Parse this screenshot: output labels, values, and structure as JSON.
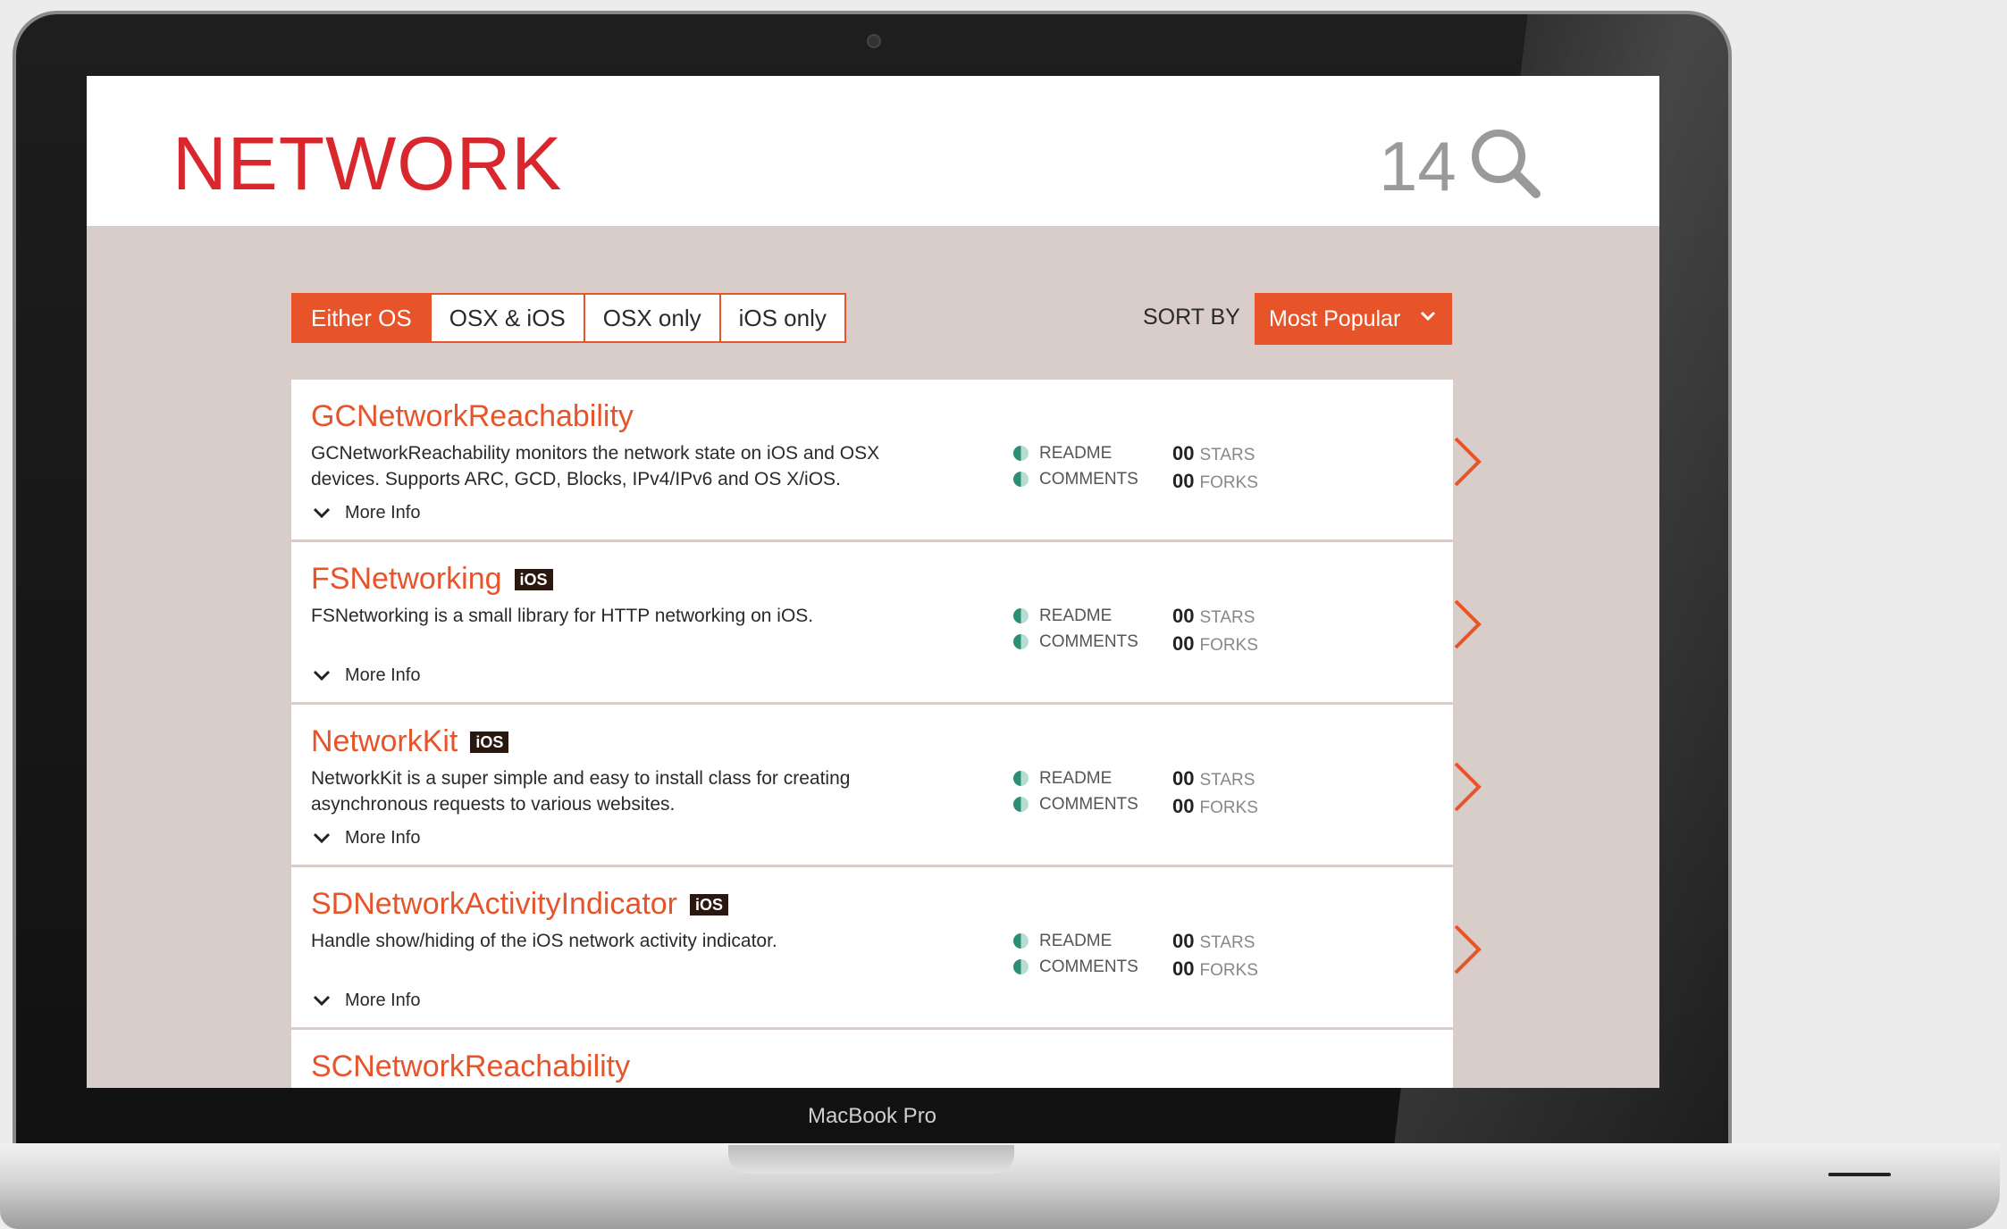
{
  "page": {
    "title": "NETWORK",
    "count": "14"
  },
  "filters": {
    "options": [
      "Either OS",
      "OSX & iOS",
      "OSX only",
      "iOS only"
    ],
    "active": "Either OS"
  },
  "sort": {
    "label": "SORT BY",
    "value": "Most Popular"
  },
  "items": [
    {
      "name": "GCNetworkReachability",
      "badge": "",
      "desc_lines": [
        "GCNetworkReachability monitors the network state on iOS and OSX",
        "devices. Supports ARC, GCD, Blocks, IPv4/IPv6 and OS X/iOS."
      ],
      "readme": "README",
      "comments": "COMMENTS",
      "stars_value": "00",
      "stars_label": "STARS",
      "forks_value": "00",
      "forks_label": "FORKS",
      "more": "More Info"
    },
    {
      "name": "FSNetworking",
      "badge": "iOS",
      "desc_lines": [
        "FSNetworking is a small library for HTTP networking on iOS.",
        ""
      ],
      "readme": "README",
      "comments": "COMMENTS",
      "stars_value": "00",
      "stars_label": "STARS",
      "forks_value": "00",
      "forks_label": "FORKS",
      "more": "More Info"
    },
    {
      "name": "NetworkKit",
      "badge": "iOS",
      "desc_lines": [
        "NetworkKit is a super simple and easy to install class for creating",
        "asynchronous requests to various websites."
      ],
      "readme": "README",
      "comments": "COMMENTS",
      "stars_value": "00",
      "stars_label": "STARS",
      "forks_value": "00",
      "forks_label": "FORKS",
      "more": "More Info"
    },
    {
      "name": "SDNetworkActivityIndicator",
      "badge": "iOS",
      "desc_lines": [
        "Handle show/hiding of the iOS network activity indicator.",
        ""
      ],
      "readme": "README",
      "comments": "COMMENTS",
      "stars_value": "00",
      "stars_label": "STARS",
      "forks_value": "00",
      "forks_label": "FORKS",
      "more": "More Info"
    },
    {
      "name": "SCNetworkReachability"
    }
  ],
  "device": {
    "label": "MacBook Pro"
  },
  "colors": {
    "accent": "#e8542a",
    "title_red": "#d9272e",
    "content_bg": "#d8cdc9"
  },
  "icons": {
    "search": "search-icon",
    "row_arrow": "chevron-right-icon",
    "more_info": "chevron-down-icon",
    "sort_dropdown": "chevron-down-icon"
  }
}
